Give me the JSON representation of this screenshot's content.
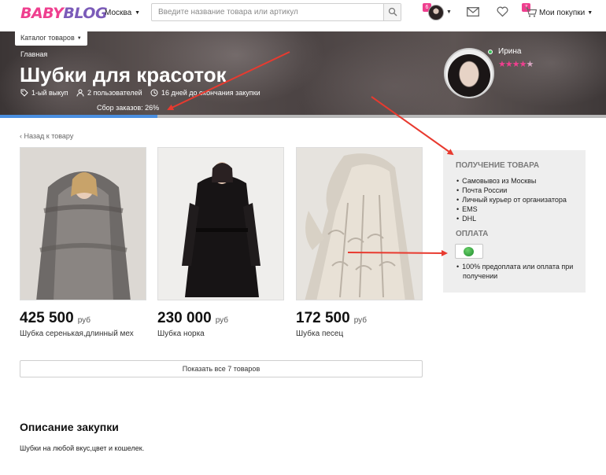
{
  "header": {
    "logo_part1": "BABY",
    "logo_part2": "BLOG",
    "city": "Москва",
    "search_placeholder": "Введите название товара или артикул",
    "avatar_badge": "6",
    "cart_badge": "7",
    "purchases_label": "Мои покупки"
  },
  "hero": {
    "catalog_button": "Каталог товаров",
    "breadcrumb": "Главная",
    "title": "Шубки для красоток",
    "meta_round": "1-ый выкуп",
    "meta_users": "2 пользователей",
    "meta_days": "16 дней до окончания закупки",
    "progress_label": "Сбор заказов: 26%",
    "progress_value": 0.26,
    "progress_color": "#4a8fe0",
    "organizer_name": "Ирина",
    "rating_filled": "★★★★",
    "rating_empty": "★"
  },
  "main": {
    "back_link": "‹ Назад к товару",
    "products": [
      {
        "price": "425 500",
        "currency": "руб",
        "name": "Шубка серенькая,длинный мех"
      },
      {
        "price": "230 000",
        "currency": "руб",
        "name": "Шубка норка"
      },
      {
        "price": "172 500",
        "currency": "руб",
        "name": "Шубка песец"
      }
    ],
    "show_all_button": "Показать все 7 товаров",
    "description_title": "Описание закупки",
    "description_text": "Шубки на любой вкус,цвет и кошелек."
  },
  "sidebar": {
    "delivery_heading": "ПОЛУЧЕНИЕ ТОВАРА",
    "delivery_options": [
      "Самовывоз из Москвы",
      "Почта России",
      "Личный курьер от организатора",
      "EMS",
      "DHL"
    ],
    "payment_heading": "ОПЛАТА",
    "payment_notes": [
      "100% предоплата или оплата при получении"
    ]
  },
  "colors": {
    "brand_pink": "#ef3f8f",
    "brand_purple": "#7b5bb9",
    "annotation_red": "#e83a2f"
  }
}
